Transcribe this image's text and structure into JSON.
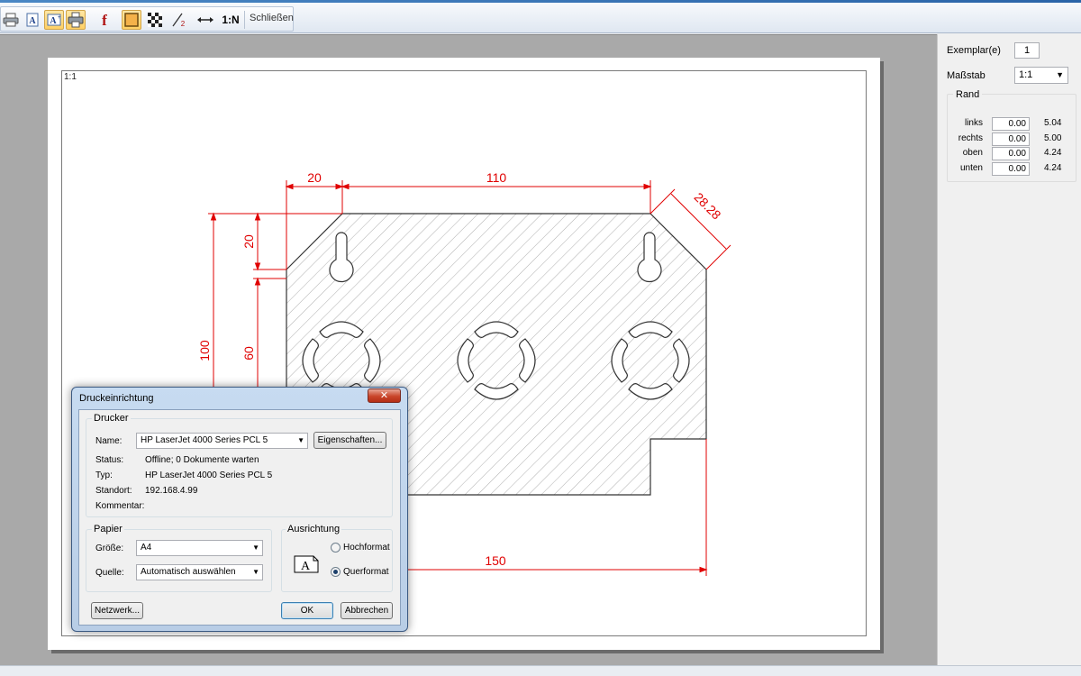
{
  "toolbar": {
    "close_label": "Schließen",
    "scale_button_label": "1:N",
    "buttons": [
      {
        "icon": "printer-icon"
      },
      {
        "icon": "text-a-icon"
      },
      {
        "icon": "text-frame-icon"
      },
      {
        "icon": "printer-setup-icon"
      },
      {
        "icon": "font-icon"
      },
      {
        "icon": "fill-icon"
      },
      {
        "icon": "checkerboard-icon"
      },
      {
        "icon": "fraction-icon"
      },
      {
        "icon": "fit-width-icon"
      }
    ]
  },
  "preview": {
    "scale_tag": "1:1",
    "dimensions": {
      "d20_top": "20",
      "d110": "110",
      "d2828": "28.28",
      "d20_left": "20",
      "d100": "100",
      "d60": "60",
      "d150": "150"
    }
  },
  "right_panel": {
    "copies_label": "Exemplar(e)",
    "copies_value": "1",
    "scale_label": "Maßstab",
    "scale_value": "1:1",
    "margin_title": "Rand",
    "margins": [
      {
        "label": "links",
        "input": "0.00",
        "value": "5.04"
      },
      {
        "label": "rechts",
        "input": "0.00",
        "value": "5.00"
      },
      {
        "label": "oben",
        "input": "0.00",
        "value": "4.24"
      },
      {
        "label": "unten",
        "input": "0.00",
        "value": "4.24"
      }
    ]
  },
  "dialog": {
    "title": "Druckeinrichtung",
    "close_glyph": "✕",
    "printer_group": "Drucker",
    "name_label": "Name:",
    "name_value": "HP LaserJet 4000 Series PCL 5",
    "properties_button": "Eigenschaften...",
    "status_label": "Status:",
    "status_value": "Offline; 0 Dokumente warten",
    "type_label": "Typ:",
    "type_value": "HP LaserJet 4000 Series PCL 5",
    "location_label": "Standort:",
    "location_value": "192.168.4.99",
    "comment_label": "Kommentar:",
    "comment_value": "",
    "paper_group": "Papier",
    "size_label": "Größe:",
    "size_value": "A4",
    "source_label": "Quelle:",
    "source_value": "Automatisch auswählen",
    "orientation_group": "Ausrichtung",
    "portrait_label": "Hochformat",
    "landscape_label": "Querformat",
    "orientation_icon_letter": "A",
    "network_button": "Netzwerk...",
    "ok_button": "OK",
    "cancel_button": "Abbrechen"
  }
}
